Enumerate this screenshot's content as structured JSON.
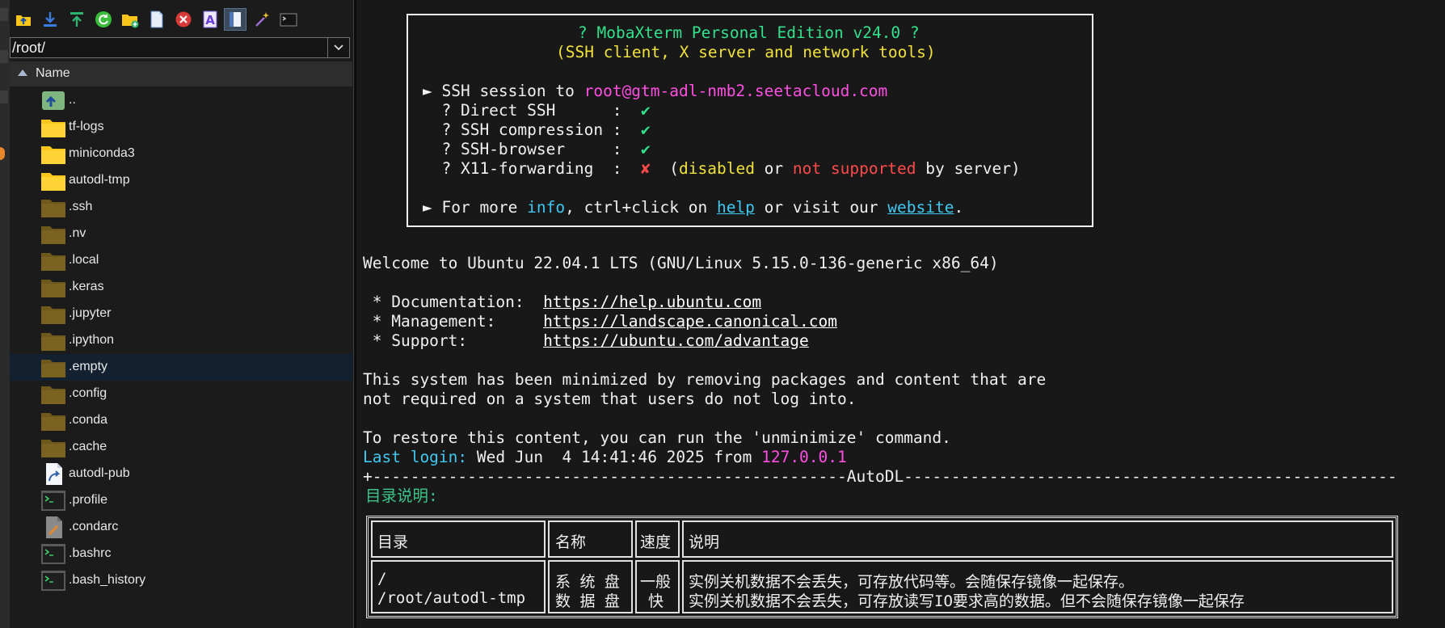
{
  "colors": {
    "terminal_bg": "#181818",
    "sidebar_bg": "#1b1b1b",
    "banner_title": "#33e08c",
    "banner_subtitle": "#f0e23a",
    "host": "#ff4fe2",
    "check": "#33e08c",
    "cross": "#ff4a4a",
    "link": "#3fc9f2",
    "folder_open": "#f9c51a",
    "folder_hidden": "#7a6320"
  },
  "toolbar": {
    "buttons": [
      {
        "name": "parent-dir",
        "icon": "folder-up-arrow-icon"
      },
      {
        "name": "download",
        "icon": "download-arrow-icon"
      },
      {
        "name": "upload",
        "icon": "upload-arrow-icon"
      },
      {
        "name": "refresh",
        "icon": "refresh-icon"
      },
      {
        "name": "new-folder",
        "icon": "new-folder-icon"
      },
      {
        "name": "new-file",
        "icon": "new-file-icon"
      },
      {
        "name": "delete",
        "icon": "delete-icon"
      },
      {
        "name": "rename",
        "icon": "rename-icon"
      },
      {
        "name": "view-toggle",
        "icon": "document-view-icon"
      },
      {
        "name": "magic",
        "icon": "magic-wand-icon"
      },
      {
        "name": "terminal",
        "icon": "terminal-icon"
      }
    ]
  },
  "sidebar": {
    "path": "/root/",
    "column_header": "Name",
    "files": [
      {
        "name": "..",
        "type": "parent"
      },
      {
        "name": "tf-logs",
        "type": "folder"
      },
      {
        "name": "miniconda3",
        "type": "folder"
      },
      {
        "name": "autodl-tmp",
        "type": "folder"
      },
      {
        "name": ".ssh",
        "type": "hidden-folder"
      },
      {
        "name": ".nv",
        "type": "hidden-folder"
      },
      {
        "name": ".local",
        "type": "hidden-folder"
      },
      {
        "name": ".keras",
        "type": "hidden-folder"
      },
      {
        "name": ".jupyter",
        "type": "hidden-folder"
      },
      {
        "name": ".ipython",
        "type": "hidden-folder"
      },
      {
        "name": ".empty",
        "type": "hidden-folder",
        "selected": true
      },
      {
        "name": ".config",
        "type": "hidden-folder"
      },
      {
        "name": ".conda",
        "type": "hidden-folder"
      },
      {
        "name": ".cache",
        "type": "hidden-folder"
      },
      {
        "name": "autodl-pub",
        "type": "link"
      },
      {
        "name": ".profile",
        "type": "shell"
      },
      {
        "name": ".condarc",
        "type": "textfile"
      },
      {
        "name": ".bashrc",
        "type": "shell"
      },
      {
        "name": ".bash_history",
        "type": "shell"
      }
    ]
  },
  "banner": {
    "title": "? MobaXterm Personal Edition v24.0 ?",
    "subtitle": "(SSH client, X server and network tools)",
    "session_prefix": "► SSH session to ",
    "session_host": "root@gtm-adl-nmb2.seetacloud.com",
    "features": [
      {
        "label": "  ? Direct SSH      :  ",
        "mark": "✔",
        "ok": true
      },
      {
        "label": "  ? SSH compression :  ",
        "mark": "✔",
        "ok": true
      },
      {
        "label": "  ? SSH-browser     :  ",
        "mark": "✔",
        "ok": true
      },
      {
        "label": "  ? X11-forwarding  :  ",
        "mark": "✘",
        "ok": false
      }
    ],
    "x11_note": {
      "open": "  (",
      "disabled": "disabled",
      "or": " or ",
      "not_supported": "not supported",
      "close": " by server)"
    },
    "more_info": {
      "prefix": "► For more ",
      "info": "info",
      "mid1": ", ctrl+click on ",
      "help": "help",
      "mid2": " or visit our ",
      "website": "website",
      "end": "."
    }
  },
  "terminal": {
    "welcome": "Welcome to Ubuntu 22.04.1 LTS (GNU/Linux 5.15.0-136-generic x86_64)",
    "links": [
      {
        "label": " * Documentation:  ",
        "url": "https://help.ubuntu.com"
      },
      {
        "label": " * Management:     ",
        "url": "https://landscape.canonical.com"
      },
      {
        "label": " * Support:        ",
        "url": "https://ubuntu.com/advantage"
      }
    ],
    "minimized_1": "This system has been minimized by removing packages and content that are",
    "minimized_2": "not required on a system that users do not log into.",
    "restore": "To restore this content, you can run the 'unminimize' command.",
    "last_login_label": "Last login:",
    "last_login_value": " Wed Jun  4 14:41:46 2025 from ",
    "last_login_ip": "127.0.0.1",
    "separator": "+--------------------------------------------------AutoDL----------------------------------------------------",
    "dir_title": "目录说明:",
    "table": {
      "headers": [
        "目录",
        "名称",
        "速度",
        "说明"
      ],
      "rows": [
        {
          "dir": "/",
          "name": "系 统 盘",
          "speed": "一般",
          "desc": "实例关机数据不会丢失，可存放代码等。会随保存镜像一起保存。"
        },
        {
          "dir": "/root/autodl-tmp",
          "name": "数 据 盘",
          "speed": "快",
          "desc": "实例关机数据不会丢失，可存放读写IO要求高的数据。但不会随保存镜像一起保存"
        }
      ]
    }
  }
}
